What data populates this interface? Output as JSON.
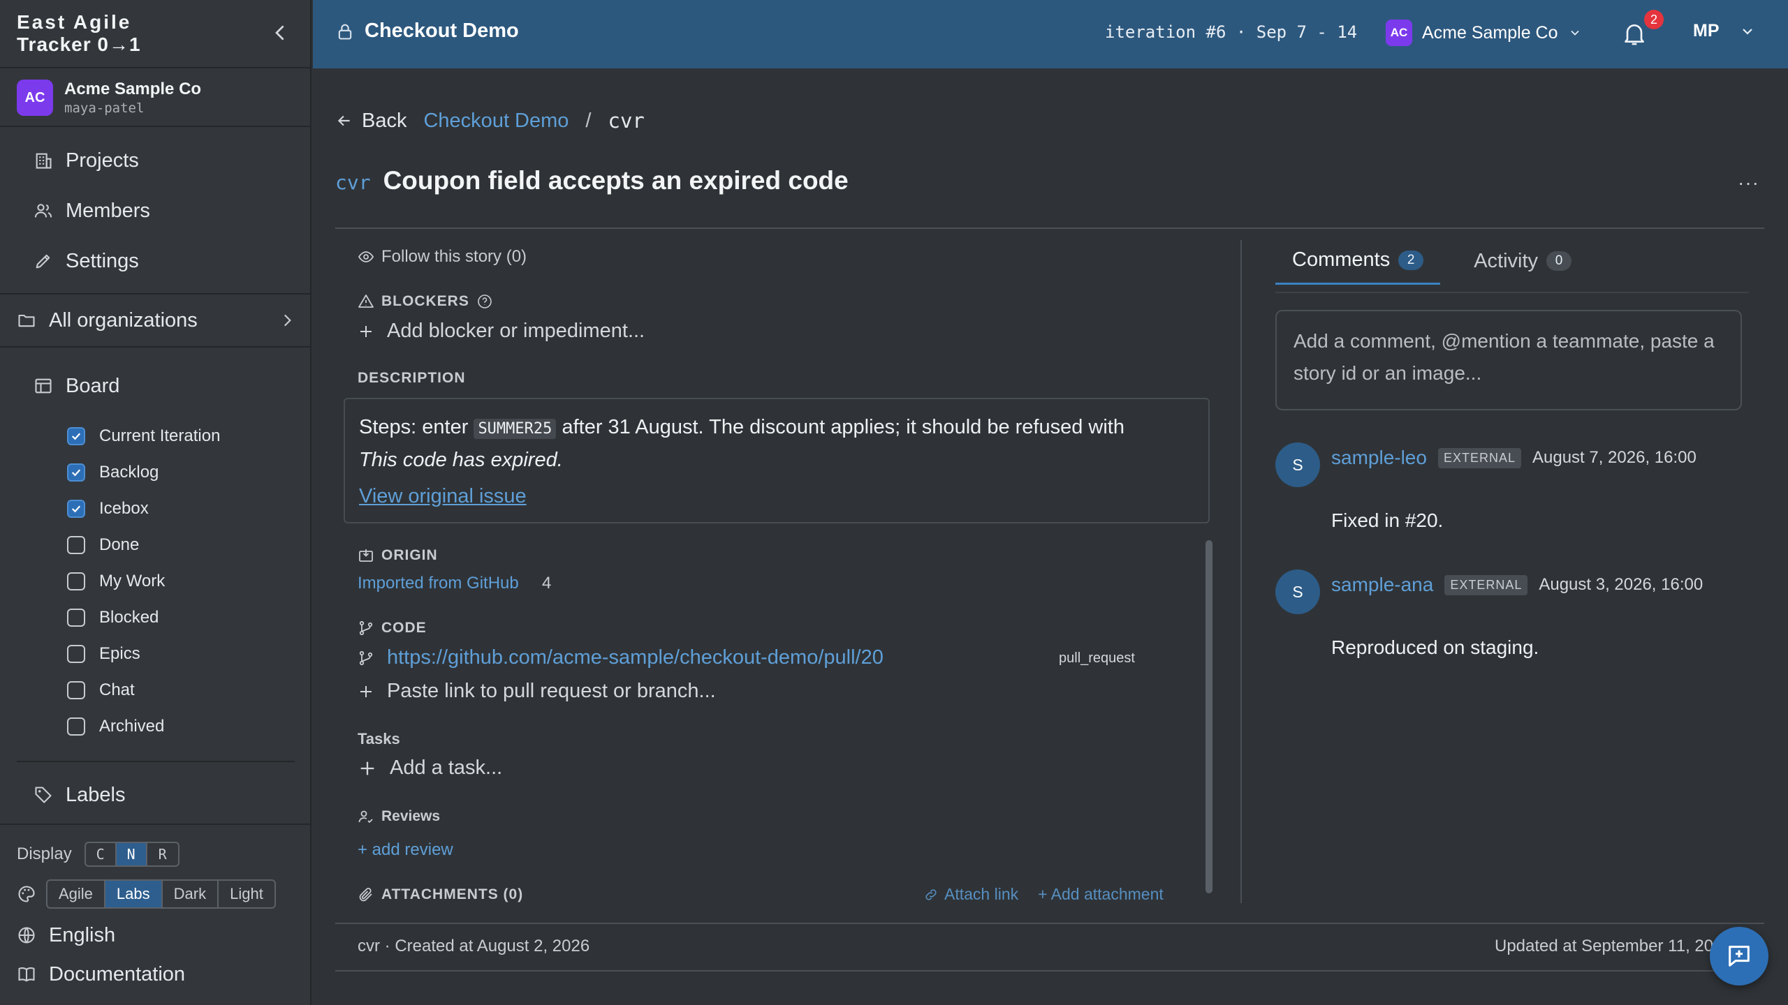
{
  "app": {
    "brand_line1": "East Agile",
    "brand_line2": "Tracker 0→1"
  },
  "org": {
    "initials": "AC",
    "name": "Acme Sample Co",
    "user": "maya-patel"
  },
  "nav": {
    "projects": "Projects",
    "members": "Members",
    "settings": "Settings",
    "all_orgs": "All organizations",
    "board": "Board",
    "labels": "Labels"
  },
  "board_filters": [
    {
      "label": "Current Iteration",
      "checked": true
    },
    {
      "label": "Backlog",
      "checked": true
    },
    {
      "label": "Icebox",
      "checked": true
    },
    {
      "label": "Done",
      "checked": false
    },
    {
      "label": "My Work",
      "checked": false
    },
    {
      "label": "Blocked",
      "checked": false
    },
    {
      "label": "Epics",
      "checked": false
    },
    {
      "label": "Chat",
      "checked": false
    },
    {
      "label": "Archived",
      "checked": false
    }
  ],
  "display": {
    "label": "Display",
    "options": [
      "C",
      "N",
      "R"
    ],
    "selected": "N"
  },
  "theme": {
    "options": [
      "Agile",
      "Labs",
      "Dark",
      "Light"
    ],
    "selected": "Labs"
  },
  "footer_links": {
    "language": "English",
    "docs": "Documentation"
  },
  "topbar": {
    "project": "Checkout Demo",
    "iteration": "iteration #6 · Sep 7 - 14",
    "org_initials": "AC",
    "org_name": "Acme Sample Co",
    "notifications": "2",
    "user_initials": "MP"
  },
  "breadcrumb": {
    "back": "Back",
    "project": "Checkout Demo",
    "sep": "/",
    "current": "cvr"
  },
  "story": {
    "id": "cvr",
    "title": "Coupon field accepts an expired code",
    "more": "···",
    "follow": "Follow this story (0)",
    "blockers_h": "BLOCKERS",
    "add_blocker": "Add blocker or impediment...",
    "description_h": "DESCRIPTION",
    "desc_pre": "Steps: enter ",
    "desc_code": "SUMMER25",
    "desc_post": " after 31 August. The discount applies; it should be refused with",
    "desc_italic": "This code has expired.",
    "desc_link": "View original issue",
    "origin_h": "ORIGIN",
    "origin_link": "Imported from GitHub",
    "origin_num": "4",
    "code_h": "CODE",
    "code_link": "https://github.com/acme-sample/checkout-demo/pull/20",
    "code_type": "pull_request",
    "paste_link": "Paste link to pull request or branch...",
    "tasks_h": "Tasks",
    "add_task": "Add a task...",
    "reviews_h": "Reviews",
    "add_review": "+ add review",
    "attachments_h": "ATTACHMENTS (0)",
    "attach_link": "Attach link",
    "add_attachment": "+ Add attachment",
    "created": "cvr  · Created at August 2, 2026",
    "updated": "Updated at September 11, 2026"
  },
  "panel": {
    "tab_comments": "Comments",
    "comments_count": "2",
    "tab_activity": "Activity",
    "activity_count": "0",
    "comment_placeholder": "Add a comment, @mention a teammate, paste a story id or an image...",
    "comments": [
      {
        "initial": "S",
        "author": "sample-leo",
        "tag": "EXTERNAL",
        "date": "August 7, 2026, 16:00",
        "body": "Fixed in #20."
      },
      {
        "initial": "S",
        "author": "sample-ana",
        "tag": "EXTERNAL",
        "date": "August 3, 2026, 16:00",
        "body": "Reproduced on staging."
      }
    ]
  },
  "colors": {
    "topbar": "#2d587e",
    "sidebar": "#33373b",
    "main": "#2f3337",
    "accent": "#5f9fd8",
    "brand_avatar": "#7c3aed",
    "badge": "#e5343d"
  }
}
